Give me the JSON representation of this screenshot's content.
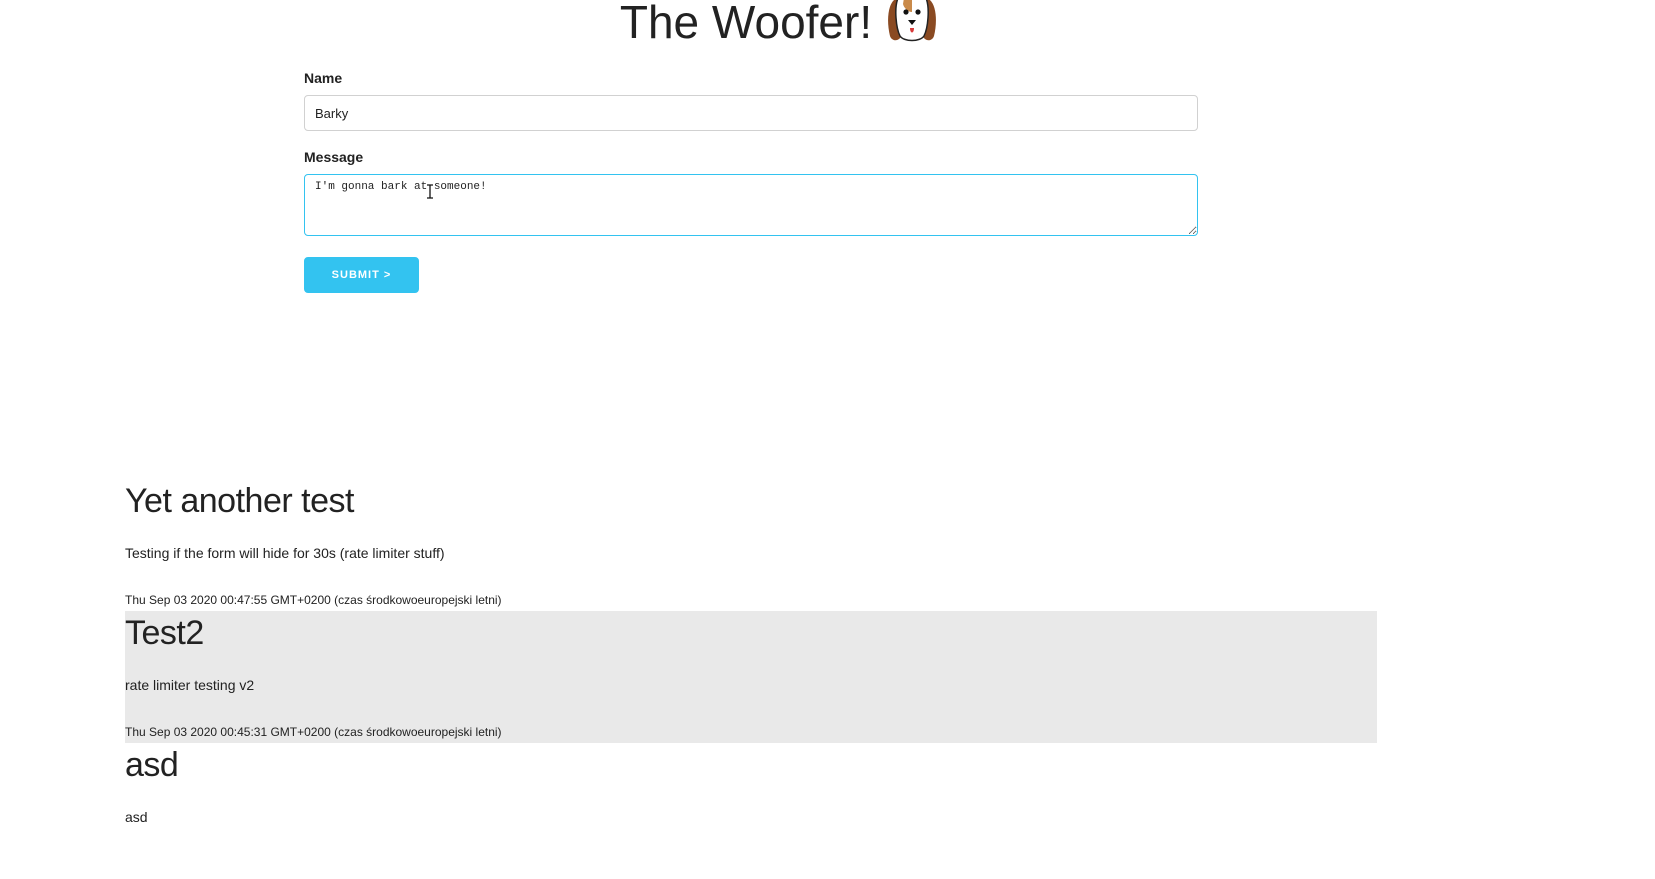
{
  "header": {
    "title": "The Woofer!",
    "logo_icon": "dog-face-icon"
  },
  "form": {
    "name_label": "Name",
    "name_value": "Barky",
    "message_label": "Message",
    "message_value": "I'm gonna bark at someone!",
    "submit_label": "SUBMIT >"
  },
  "colors": {
    "accent": "#33c3f0",
    "shaded_row": "#e9e9e9",
    "text": "#222222"
  },
  "posts": [
    {
      "title": "Yet another test",
      "body": "Testing if the form will hide for 30s (rate limiter stuff)",
      "date": "Thu Sep 03 2020 00:47:55 GMT+0200 (czas środkowoeuropejski letni)"
    },
    {
      "title": "Test2",
      "body": "rate limiter testing v2",
      "date": "Thu Sep 03 2020 00:45:31 GMT+0200 (czas środkowoeuropejski letni)"
    },
    {
      "title": "asd",
      "body": "asd"
    }
  ]
}
